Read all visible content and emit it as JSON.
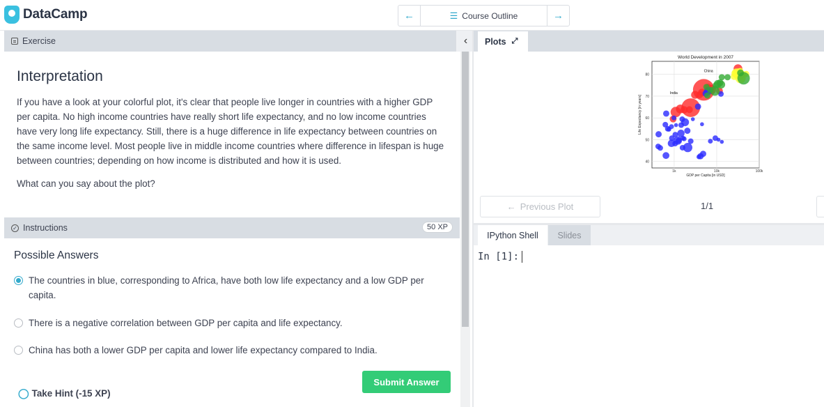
{
  "app": {
    "name": "DataCamp"
  },
  "nav": {
    "prev_icon": "arrow-left",
    "title": "Course Outline",
    "next_icon": "arrow-right"
  },
  "exercise": {
    "header": "Exercise",
    "title": "Interpretation",
    "paragraph": "If you have a look at your colorful plot, it's clear that people live longer in countries with a higher GDP per capita. No high income countries have really short life expectancy, and no low income countries have very long life expectancy. Still, there is a huge difference in life expectancy between countries on the same income level. Most people live in middle income countries where difference in lifespan is huge between countries; depending on how income is distributed and how it is used.",
    "question": "What can you say about the plot?"
  },
  "instructions": {
    "header": "Instructions",
    "xp": "50 XP"
  },
  "answers": {
    "heading": "Possible Answers",
    "options": [
      {
        "label": "The countries in blue, corresponding to Africa, have both low life expectancy and a low GDP per capita.",
        "selected": true
      },
      {
        "label": "There is a negative correlation between GDP per capita and life expectancy.",
        "selected": false
      },
      {
        "label": "China has both a lower GDP per capita and lower life expectancy compared to India.",
        "selected": false
      }
    ],
    "submit": "Submit Answer",
    "hint": "Take Hint (-15 XP)"
  },
  "plots": {
    "tab": "Plots",
    "prev": "Previous Plot",
    "page": "1/1"
  },
  "shell": {
    "tabs": [
      "IPython Shell",
      "Slides"
    ],
    "prompt": "In [1]:"
  },
  "chart_data": {
    "type": "scatter",
    "title": "World Development in 2007",
    "xlabel": "GDP per Capita [in USD]",
    "ylabel": "Life Expectancy [in years]",
    "xscale": "log",
    "xlim": [
      300,
      100000
    ],
    "ylim": [
      37,
      86
    ],
    "xticks": [
      1000,
      10000,
      100000
    ],
    "xticklabels": [
      "1k",
      "10k",
      "100k"
    ],
    "yticks": [
      40,
      50,
      60,
      70,
      80
    ],
    "grid": true,
    "annotations": [
      {
        "text": "China",
        "x": 5000,
        "y": 81
      },
      {
        "text": "India",
        "x": 800,
        "y": 71
      }
    ],
    "colors": {
      "Asia": "#ff2a2a",
      "Africa": "#2a2aff",
      "Europe": "#ffff33",
      "Americas": "#33aa33"
    },
    "series": [
      {
        "color": "#ff2a2a",
        "points": [
          [
            4959,
            72.9,
            60
          ],
          [
            2452,
            64.7,
            45
          ],
          [
            1091,
            62.7,
            14
          ],
          [
            1391,
            64.1,
            10
          ],
          [
            3095,
            70.6,
            8
          ],
          [
            7458,
            73.0,
            12
          ],
          [
            6223,
            74.2,
            6
          ],
          [
            31656,
            82.6,
            10
          ],
          [
            4471,
            71.7,
            7
          ],
          [
            2280,
            63.8,
            6
          ],
          [
            1713,
            63.7,
            7
          ],
          [
            944,
            59.5,
            6
          ],
          [
            11605,
            72.4,
            6
          ],
          [
            3970,
            70.6,
            6
          ]
        ]
      },
      {
        "color": "#2a2aff",
        "points": [
          [
            641,
            42.7,
            6
          ],
          [
            1441,
            52.9,
            7
          ],
          [
            863,
            48.3,
            7
          ],
          [
            1217,
            49.6,
            9
          ],
          [
            2082,
            46.4,
            11
          ],
          [
            4797,
            43.5,
            5
          ],
          [
            6223,
            72.3,
            8
          ],
          [
            1463,
            56.7,
            4
          ],
          [
            1544,
            59.4,
            4
          ],
          [
            2451,
            49.3,
            4
          ],
          [
            706,
            55.0,
            4
          ],
          [
            2042,
            54.1,
            5
          ],
          [
            12570,
            71.0,
            4
          ],
          [
            1803,
            58.0,
            8
          ],
          [
            420,
            46.9,
            4
          ],
          [
            9269,
            50.7,
            4
          ],
          [
            3632,
            65.2,
            5
          ],
          [
            1056,
            48.2,
            4
          ],
          [
            1060,
            52.3,
            4
          ],
          [
            5581,
            71.2,
            6
          ],
          [
            7092,
            49.3,
            3
          ],
          [
            986,
            60.0,
            3
          ],
          [
            3820,
            42.1,
            3
          ],
          [
            752,
            54.8,
            3
          ],
          [
            1598,
            50.7,
            3
          ],
          [
            863,
            56.0,
            3
          ],
          [
            4513,
            57.1,
            2
          ],
          [
            1107,
            56.7,
            2
          ],
          [
            2749,
            59.4,
            2
          ],
          [
            430,
            52.5,
            5
          ],
          [
            882,
            50.7,
            4
          ],
          [
            1270,
            49.6,
            4
          ],
          [
            1712,
            50.4,
            3
          ],
          [
            470,
            46.2,
            4
          ],
          [
            11000,
            50.0,
            2
          ],
          [
            13206,
            49.0,
            2
          ],
          [
            649,
            62.0,
            5
          ],
          [
            1569,
            46.3,
            4
          ],
          [
            4173,
            42.4,
            5
          ],
          [
            619,
            56.9,
            4
          ]
        ]
      },
      {
        "color": "#ffff33",
        "points": [
          [
            36126,
            79.8,
            9
          ],
          [
            33692,
            79.4,
            6
          ],
          [
            40676,
            80.2,
            5
          ],
          [
            35278,
            79.0,
            6
          ],
          [
            28569,
            79.8,
            6
          ],
          [
            27538,
            80.5,
            8
          ],
          [
            25768,
            79.0,
            6
          ],
          [
            36319,
            78.3,
            14
          ],
          [
            33207,
            80.9,
            9
          ],
          [
            49357,
            80.2,
            5
          ],
          [
            36180,
            81.7,
            4
          ],
          [
            28821,
            80.9,
            8
          ]
        ]
      },
      {
        "color": "#33aa33",
        "points": [
          [
            42952,
            78.2,
            20
          ],
          [
            36319,
            80.7,
            6
          ],
          [
            9065,
            72.4,
            12
          ],
          [
            12779,
            75.3,
            8
          ],
          [
            9645,
            74.9,
            6
          ],
          [
            11977,
            76.2,
            6
          ],
          [
            7007,
            72.9,
            5
          ],
          [
            10611,
            75.6,
            8
          ],
          [
            13172,
            78.7,
            5
          ],
          [
            6025,
            70.3,
            5
          ],
          [
            5728,
            74.2,
            5
          ],
          [
            18008,
            78.7,
            5
          ]
        ]
      }
    ]
  }
}
